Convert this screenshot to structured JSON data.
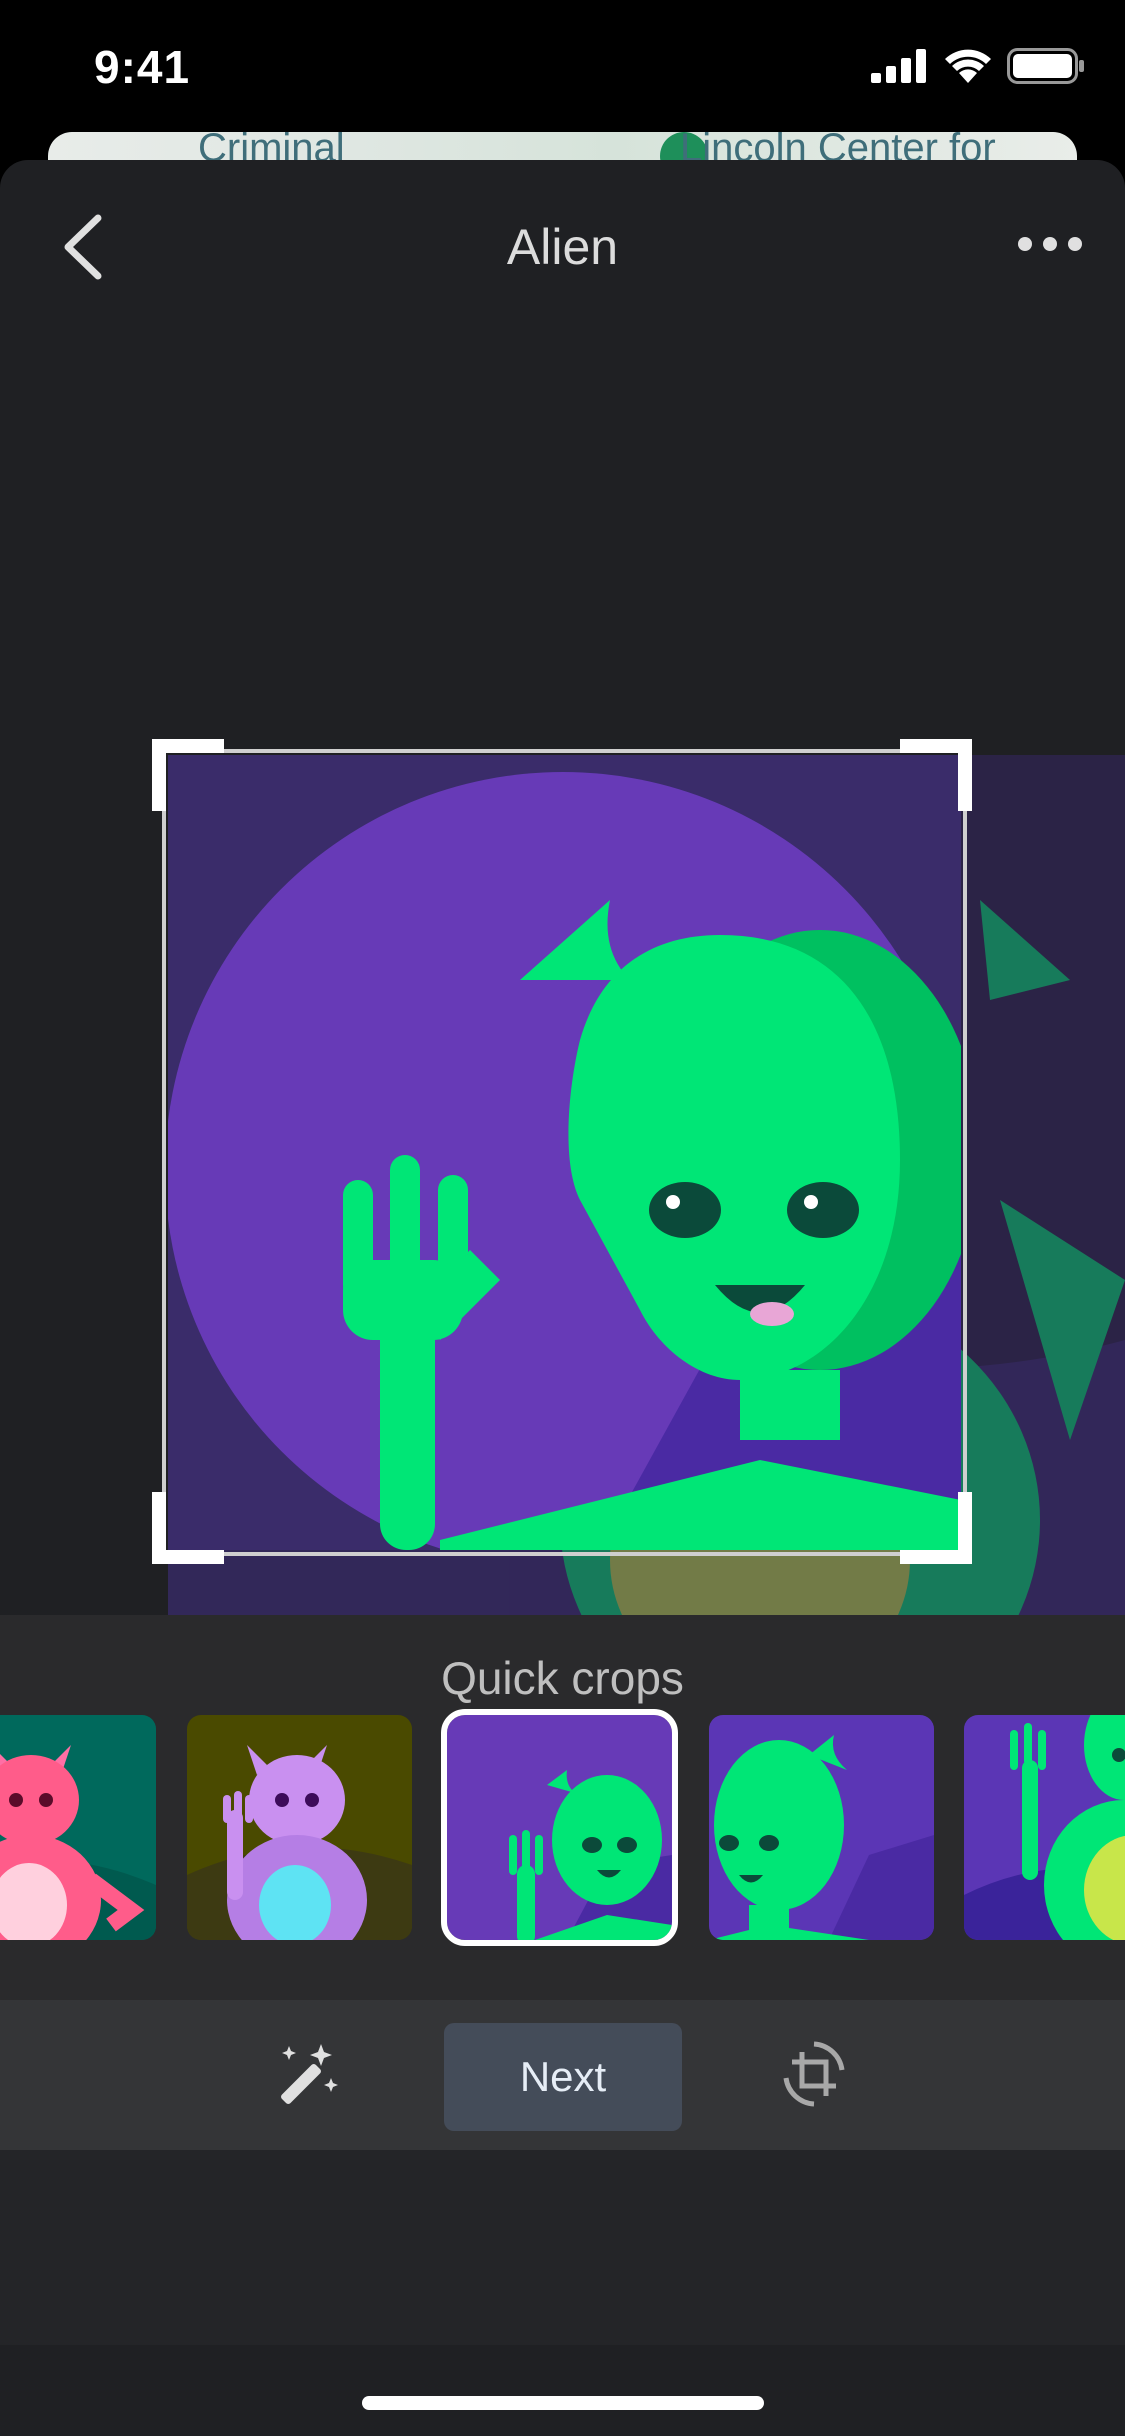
{
  "status_bar": {
    "time": "9:41"
  },
  "map": {
    "label_left": "Criminal",
    "label_right": "Lincoln Center for"
  },
  "header": {
    "title": "Alien"
  },
  "quick_crops": {
    "title": "Quick crops",
    "selected_index": 2
  },
  "footer": {
    "next_label": "Next"
  },
  "colors": {
    "sheet_bg": "#1f2023",
    "panel_bg": "#2a2a2c",
    "toolbar_bg": "#343537",
    "alien_green": "#00e676",
    "purple": "#673ab7",
    "button_bg": "#444c59"
  },
  "icons": {
    "back": "chevron-left-icon",
    "more": "more-horizontal-icon",
    "tool_1": "magic-wand-icon",
    "tool_2": "paint-bucket-icon",
    "tool_3": "crop-rotate-icon"
  }
}
